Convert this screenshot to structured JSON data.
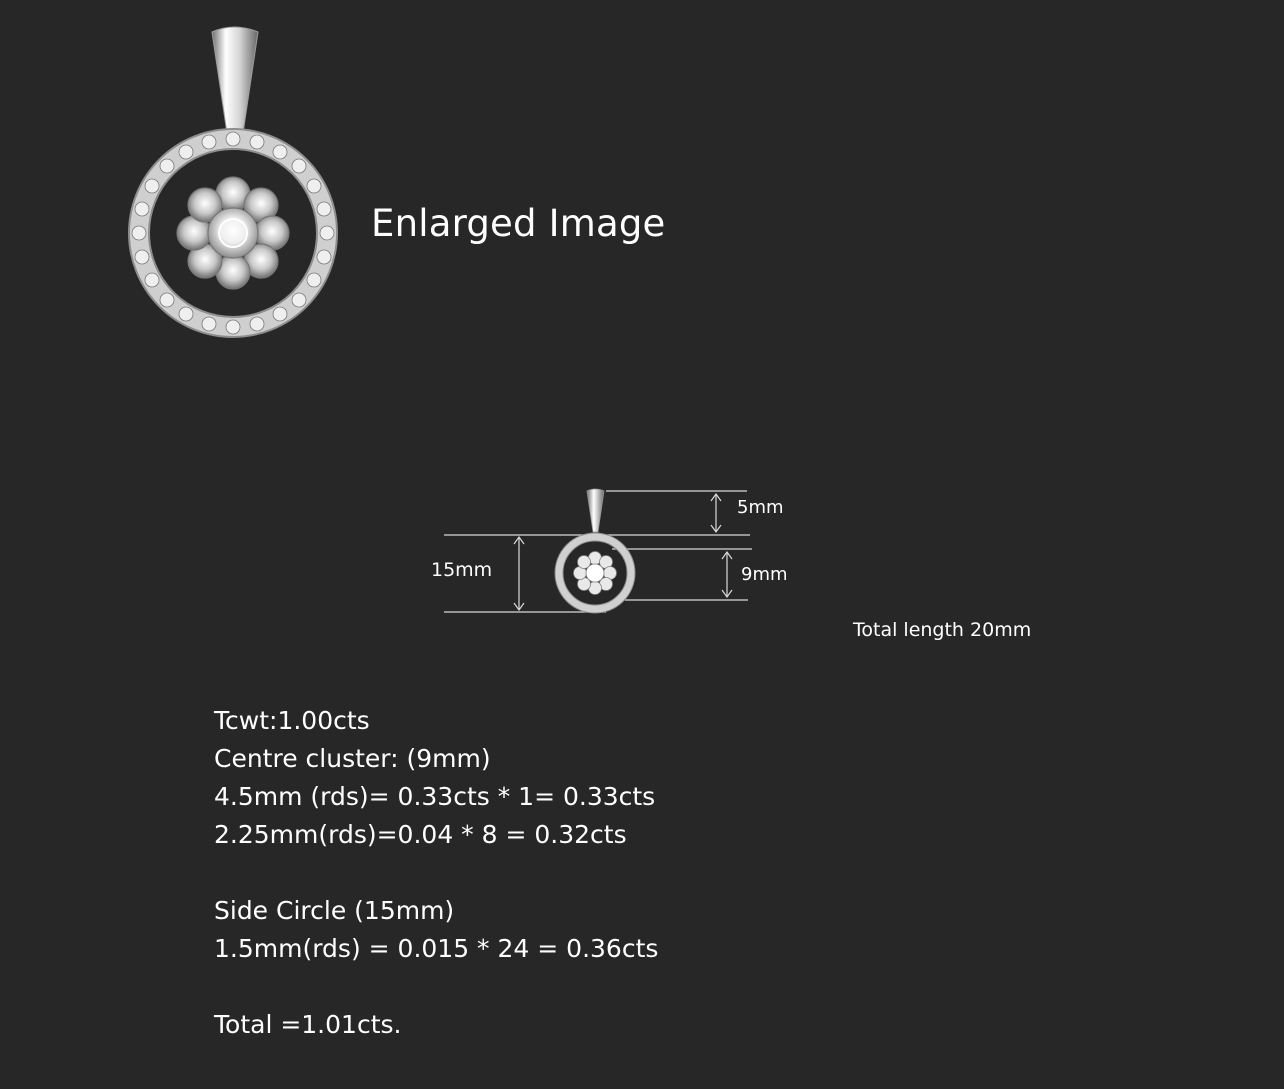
{
  "header": {
    "title": "Enlarged Image"
  },
  "dimensions": {
    "bail": "5mm",
    "cluster": "9mm",
    "circle": "15mm",
    "total_length": "Total length 20mm"
  },
  "specs": {
    "line_1": "Tcwt:1.00cts",
    "line_2": "Centre cluster: (9mm)",
    "line_3": "4.5mm (rds)= 0.33cts * 1= 0.33cts",
    "line_4": "2.25mm(rds)=0.04 * 8 = 0.32cts",
    "line_5": "Side Circle (15mm)",
    "line_6": "1.5mm(rds) = 0.015 * 24  = 0.36cts",
    "line_7": "Total =1.01cts."
  },
  "colors": {
    "background": "#272727",
    "text": "#ffffff",
    "metal": "#d8d8d8"
  }
}
